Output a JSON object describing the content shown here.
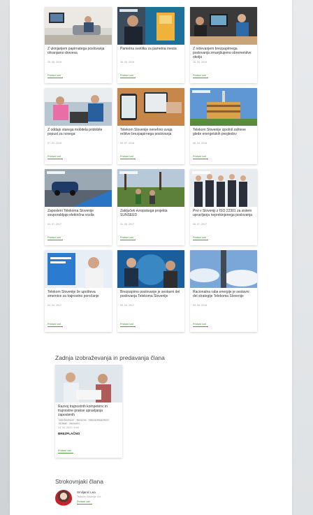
{
  "cards": [
    {
      "title": "Z ukinjanjem papirnatega poslovanja ohranjamo drevesa",
      "date": "29. 08. 2019",
      "more": "Preberi več"
    },
    {
      "title": "Pametna svetilka za pametna mesta",
      "date": "30. 05. 2019",
      "more": "Preberi več"
    },
    {
      "title": "Z reševanjem brezpapirnega poslovanja zmanjšujemo obremenitve okolja",
      "date": "15. 05. 2019",
      "more": "Preberi več"
    },
    {
      "title": "Z oddajo starega mobitela pridobite popust za novega",
      "date": "07. 01. 2019",
      "more": "Preberi več"
    },
    {
      "title": "Telekom Slovenije nenehno uvaja rešitve brezpapirnega poslovanja",
      "date": "03. 07. 2018",
      "more": "Preberi več"
    },
    {
      "title": "Telekom Slovenije izpolnil zahteve glede energetskih pregledov",
      "date": "06. 04. 2018",
      "more": "Preberi več"
    },
    {
      "title": "Zaposleni Telekoma Slovenije souporabljajo električna vozila",
      "date": "03. 07. 2017",
      "more": "Preberi več"
    },
    {
      "title": "Zaključek evropskega projekta SUNSEED",
      "date": "31. 08. 2017",
      "more": "Preberi več"
    },
    {
      "title": "Prvi v Sloveniji z ISO 22301 za sistem upravljanja neprekinjenega poslovanja",
      "date": "06. 07. 2017",
      "more": "Preberi več"
    },
    {
      "title": "Telekom Slovenije že upošteva smernice za trajnostno poročanje",
      "date": "04. 04. 2017",
      "more": "Preberi več"
    },
    {
      "title": "Brezpapirno poslovanje je sestavni del poslovanja Telekoma Slovenije",
      "date": "03. 04. 2017",
      "more": "Preberi več"
    },
    {
      "title": "Racionalna raba energije je sestavni del strategije Telekoma Slovenije",
      "date": "03. 06. 2016",
      "more": "Preberi več"
    }
  ],
  "lectures_section": {
    "heading": "Zadnja izobraževanja in predavanja člana",
    "lecture": {
      "title": "Razvoj trajnostnih kompetenc in trajnostne prakse upravljanja zaposlenih",
      "chips": [
        "Jelja Šelj Ramiz",
        "Benjar Ga",
        "Materija Marija Morin",
        "Prj Bašk",
        "Renia Rim"
      ],
      "date": "14. 04. 2021 / 9:00",
      "price": "BREZPLAČNO",
      "more": "Preberi več"
    }
  },
  "experts_section": {
    "heading": "Strokovnjaki člana",
    "expert": {
      "name": "Smiljanić Lea",
      "org": "Telekom Slovenije, d.d.",
      "more": "Preberi več"
    }
  },
  "colors": {
    "accent": "#3a8b2c",
    "page_bg": "#ffffff",
    "outer_bg": "#e9eaeb"
  }
}
